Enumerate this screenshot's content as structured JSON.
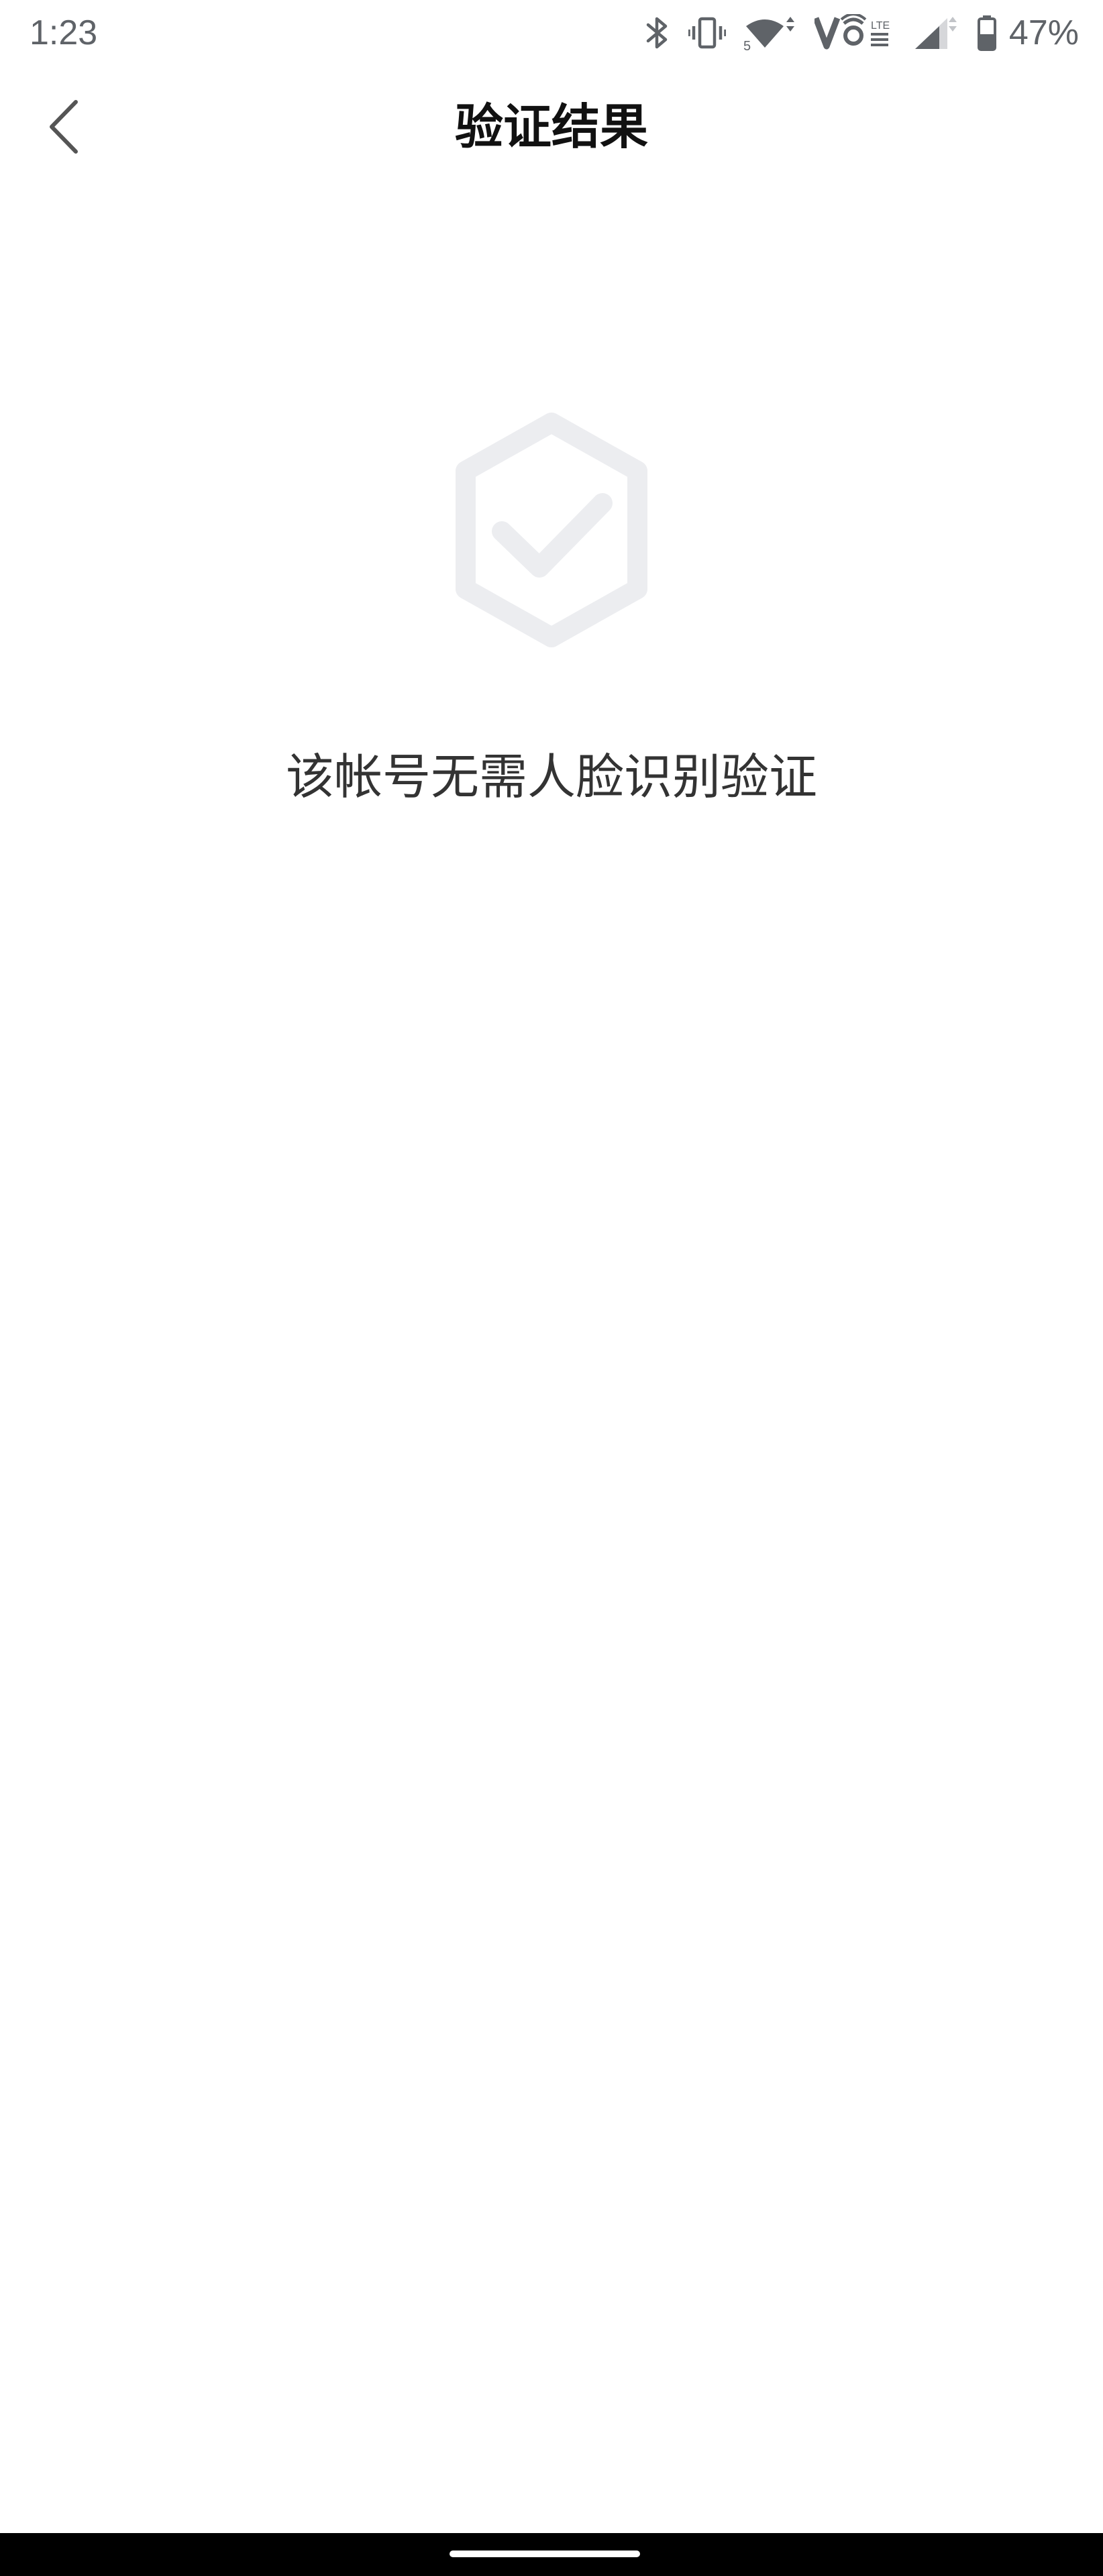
{
  "status_bar": {
    "time": "1:23",
    "battery_percent": "47%",
    "icons": [
      "bluetooth-icon",
      "vibrate-icon",
      "wifi-icon",
      "volte-icon",
      "signal-icon",
      "battery-icon"
    ],
    "color": "#5f6368"
  },
  "nav": {
    "title": "验证结果",
    "back_icon": "chevron-left-icon"
  },
  "result": {
    "icon": "shield-check-icon",
    "icon_color": "#ecedf0",
    "message": "该帐号无需人脸识别验证"
  },
  "colors": {
    "background": "#ffffff",
    "title": "#111111",
    "message": "#333333"
  }
}
